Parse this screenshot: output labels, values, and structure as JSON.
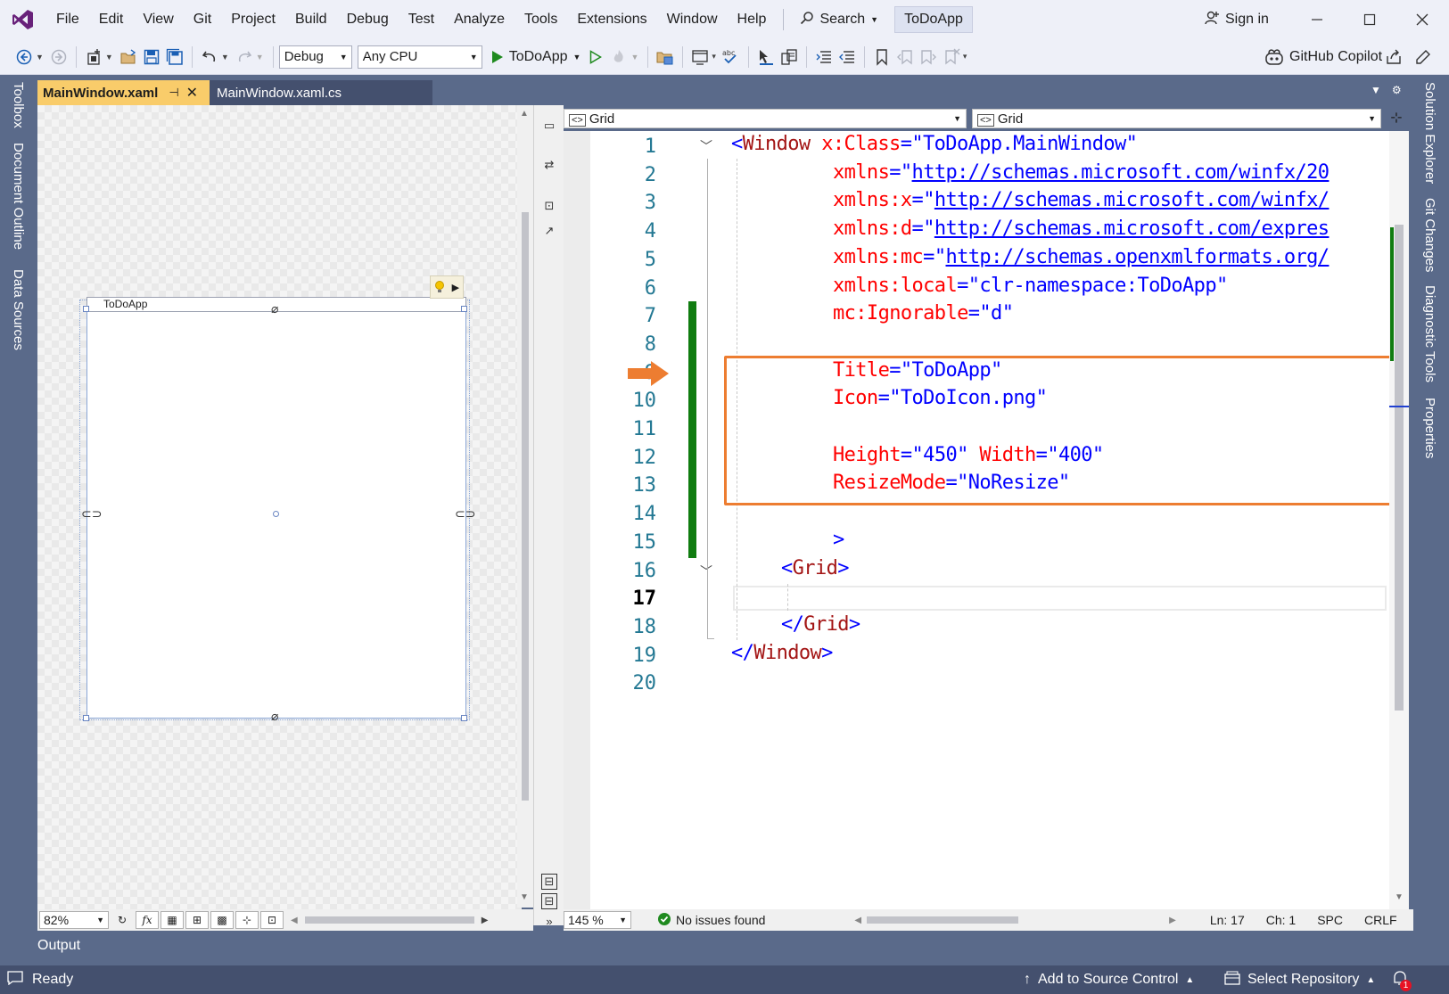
{
  "menu": {
    "items": [
      "File",
      "Edit",
      "View",
      "Git",
      "Project",
      "Build",
      "Debug",
      "Test",
      "Analyze",
      "Tools",
      "Extensions",
      "Window",
      "Help"
    ],
    "search_label": "Search",
    "solution_name": "ToDoApp",
    "sign_in": "Sign in"
  },
  "toolbar": {
    "configuration": "Debug",
    "platform": "Any CPU",
    "run_target": "ToDoApp",
    "copilot": "GitHub Copilot"
  },
  "side_tabs": {
    "left": [
      "Toolbox",
      "Document Outline",
      "Data Sources"
    ],
    "right": [
      "Solution Explorer",
      "Git Changes",
      "Diagnostic Tools",
      "Properties"
    ]
  },
  "doc_tabs": {
    "active": "MainWindow.xaml",
    "inactive": "MainWindow.xaml.cs"
  },
  "designer": {
    "window_title": "ToDoApp",
    "zoom": "82%"
  },
  "editor_nav": {
    "left": "Grid",
    "right": "Grid"
  },
  "code": {
    "line_numbers": [
      "1",
      "2",
      "3",
      "4",
      "5",
      "6",
      "7",
      "8",
      "9",
      "10",
      "11",
      "12",
      "13",
      "14",
      "15",
      "16",
      "17",
      "18",
      "19",
      "20"
    ],
    "current_line": "17",
    "lines": [
      {
        "ln": 1,
        "tokens": [
          [
            "punct",
            "<"
          ],
          [
            "tag",
            "Window"
          ],
          [
            "plain",
            " "
          ],
          [
            "attr",
            "x:Class"
          ],
          [
            "punct",
            "="
          ],
          [
            "val",
            "\"ToDoApp.MainWindow\""
          ]
        ]
      },
      {
        "ln": 2,
        "tokens": [
          [
            "attr",
            "xmlns"
          ],
          [
            "punct",
            "="
          ],
          [
            "val",
            "\""
          ],
          [
            "url",
            "http://schemas.microsoft.com/winfx/20"
          ]
        ]
      },
      {
        "ln": 3,
        "tokens": [
          [
            "attr",
            "xmlns:x"
          ],
          [
            "punct",
            "="
          ],
          [
            "val",
            "\""
          ],
          [
            "url",
            "http://schemas.microsoft.com/winfx/"
          ]
        ]
      },
      {
        "ln": 4,
        "tokens": [
          [
            "attr",
            "xmlns:d"
          ],
          [
            "punct",
            "="
          ],
          [
            "val",
            "\""
          ],
          [
            "url",
            "http://schemas.microsoft.com/expres"
          ]
        ]
      },
      {
        "ln": 5,
        "tokens": [
          [
            "attr",
            "xmlns:mc"
          ],
          [
            "punct",
            "="
          ],
          [
            "val",
            "\""
          ],
          [
            "url",
            "http://schemas.openxmlformats.org/"
          ]
        ]
      },
      {
        "ln": 6,
        "tokens": [
          [
            "attr",
            "xmlns:local"
          ],
          [
            "punct",
            "="
          ],
          [
            "val",
            "\"clr-namespace:ToDoApp\""
          ]
        ]
      },
      {
        "ln": 7,
        "tokens": [
          [
            "attr",
            "mc:Ignorable"
          ],
          [
            "punct",
            "="
          ],
          [
            "val",
            "\"d\""
          ]
        ]
      },
      {
        "ln": 9,
        "tokens": [
          [
            "attr",
            "Title"
          ],
          [
            "punct",
            "="
          ],
          [
            "val",
            "\"ToDoApp\""
          ]
        ]
      },
      {
        "ln": 10,
        "tokens": [
          [
            "attr",
            "Icon"
          ],
          [
            "punct",
            "="
          ],
          [
            "val",
            "\"ToDoIcon.png\""
          ]
        ]
      },
      {
        "ln": 12,
        "tokens": [
          [
            "attr",
            "Height"
          ],
          [
            "punct",
            "="
          ],
          [
            "val",
            "\"450\""
          ],
          [
            "plain",
            " "
          ],
          [
            "attr",
            "Width"
          ],
          [
            "punct",
            "="
          ],
          [
            "val",
            "\"400\""
          ]
        ]
      },
      {
        "ln": 13,
        "tokens": [
          [
            "attr",
            "ResizeMode"
          ],
          [
            "punct",
            "="
          ],
          [
            "val",
            "\"NoResize\""
          ]
        ]
      },
      {
        "ln": 15,
        "tokens": [
          [
            "punct",
            ">"
          ]
        ]
      },
      {
        "ln": 16,
        "tokens": [
          [
            "punct",
            "<"
          ],
          [
            "tag",
            "Grid"
          ],
          [
            "punct",
            ">"
          ]
        ]
      },
      {
        "ln": 18,
        "tokens": [
          [
            "punct",
            "</"
          ],
          [
            "tag",
            "Grid"
          ],
          [
            "punct",
            ">"
          ]
        ]
      },
      {
        "ln": 19,
        "tokens": [
          [
            "punct",
            "</"
          ],
          [
            "tag",
            "Window"
          ],
          [
            "punct",
            ">"
          ]
        ]
      }
    ]
  },
  "editor_status": {
    "zoom": "145 %",
    "issues": "No issues found",
    "line": "Ln: 17",
    "col": "Ch: 1",
    "whitespace": "SPC",
    "line_ending": "CRLF"
  },
  "output_tab": "Output",
  "statusbar": {
    "state": "Ready",
    "source_control": "Add to Source Control",
    "repository": "Select Repository",
    "notifications": "1"
  },
  "colors": {
    "accent": "#68217a",
    "highlight_box": "#ed7d31",
    "change_bar": "#107c10",
    "statusbar": "#44506e",
    "active_tab": "#f9cc6a"
  }
}
